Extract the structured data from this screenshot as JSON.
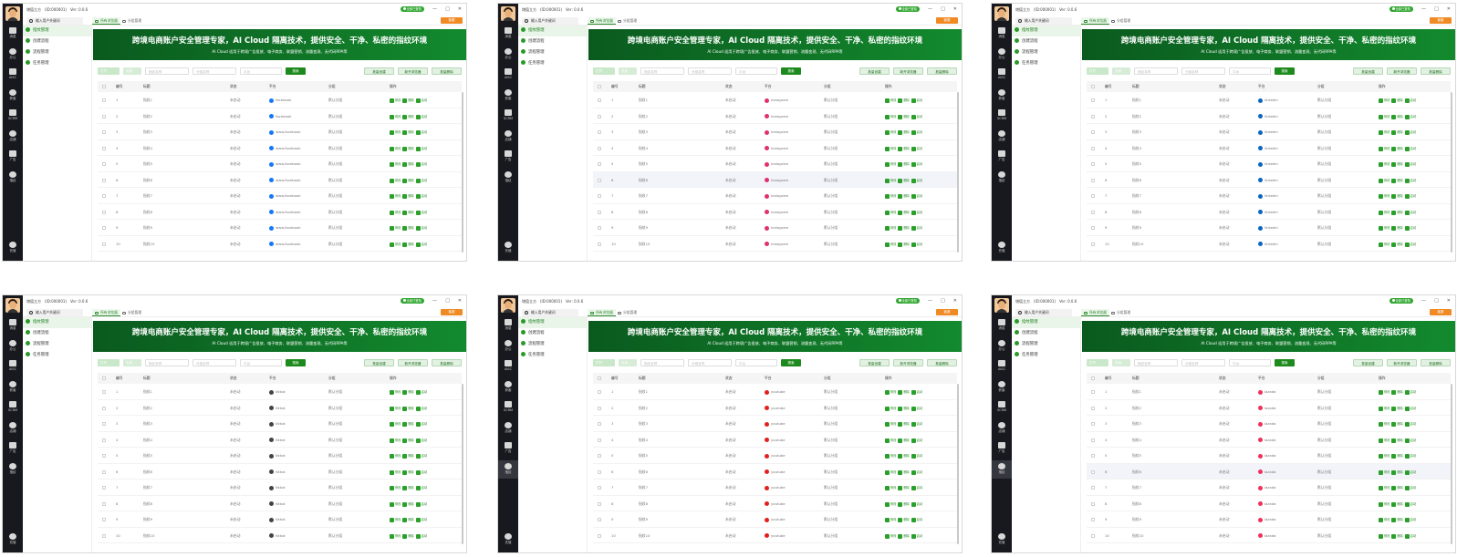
{
  "app": {
    "company": "增值立方",
    "id_label": "(ID:000001)",
    "version": "Ver: 0.0.6",
    "online_label": "全部已登陆",
    "service_label": "客服",
    "search_placeholder": "输入用户关键词"
  },
  "nav": [
    {
      "label": "消息",
      "icon": "chat-icon"
    },
    {
      "label": "办公",
      "icon": "office-icon"
    },
    {
      "label": "AISC",
      "icon": "aisc-icon"
    },
    {
      "label": "获客",
      "icon": "user-icon"
    },
    {
      "label": "SCRM",
      "icon": "scrm-icon"
    },
    {
      "label": "店铺",
      "icon": "shop-icon"
    },
    {
      "label": "广告",
      "icon": "ad-icon"
    },
    {
      "label": "指纹",
      "icon": "fingerprint-icon"
    }
  ],
  "nav_bottom": {
    "label": "充值",
    "icon": "recharge-icon"
  },
  "tabs": [
    "所有浏览器",
    "分组管理"
  ],
  "menu": [
    "指纹管理",
    "创建流程",
    "流程管理",
    "任务管理"
  ],
  "banner": {
    "title": "跨境电商账户安全管理专家，AI Cloud 隔离技术，提供安全、干净、私密的指纹环境",
    "subtitle": "AI Cloud 适用于跨境广告投放、电子商务、联盟营销、流量变现、无代码RPA等"
  },
  "toolbar": {
    "open": "打开",
    "close": "关闭",
    "name_placeholder": "指纹名称",
    "group_placeholder": "分组名称",
    "platform_placeholder": "平台",
    "search": "搜索",
    "batch_create": "批量创建",
    "new_window": "新开浏览器",
    "batch_delete": "批量删除"
  },
  "columns": [
    "编号",
    "标题",
    "状态",
    "平台",
    "分组",
    "操作"
  ],
  "actions": [
    "修改",
    "删除",
    "启动"
  ],
  "row_status": "未启动",
  "row_group": "默认分组",
  "row_titles": [
    "指纹1",
    "指纹2",
    "指纹3",
    "指纹4",
    "指纹5",
    "指纹6",
    "指纹7",
    "指纹8",
    "指纹9",
    "指纹10"
  ],
  "row_numbers": [
    "1",
    "2",
    "3",
    "4",
    "5",
    "6",
    "7",
    "8",
    "9",
    "10"
  ],
  "panels": [
    {
      "platform_name": "facebook",
      "platform_icon": "facebook-icon",
      "platform_color": "#1877f2",
      "row_platforms": [
        "facebook",
        "facebook",
        "www.facebook",
        "www.facebook",
        "www.facebook",
        "www.facebook",
        "www.facebook",
        "www.facebook",
        "www.facebook",
        "www.facebook"
      ],
      "highlight_row": -1,
      "active_nav": -1
    },
    {
      "platform_name": "instagram",
      "platform_icon": "instagram-icon",
      "platform_color": "#e1306c",
      "row_platforms": [
        "instagram",
        "instagram",
        "instagram",
        "instagram",
        "instagram",
        "instagram",
        "instagram",
        "instagram",
        "instagram",
        "instagram"
      ],
      "highlight_row": 5,
      "active_nav": -1
    },
    {
      "platform_name": "linkedin",
      "platform_icon": "linkedin-icon",
      "platform_color": "#0a66c2",
      "row_platforms": [
        "linkedin",
        "linkedin",
        "linkedin",
        "linkedin",
        "linkedin",
        "linkedin",
        "linkedin",
        "linkedin",
        "linkedin",
        "linkedin"
      ],
      "highlight_row": -1,
      "active_nav": -1
    },
    {
      "platform_name": "tiktok",
      "platform_icon": "tiktok-icon",
      "platform_color": "#444444",
      "row_platforms": [
        "tiktok",
        "tiktok",
        "tiktok",
        "tiktok",
        "tiktok",
        "tiktok",
        "tiktok",
        "tiktok",
        "tiktok",
        "tiktok"
      ],
      "highlight_row": -1,
      "active_nav": -1
    },
    {
      "platform_name": "youtube",
      "platform_icon": "youtube-icon",
      "platform_color": "#e02020",
      "row_platforms": [
        "youtube",
        "youtube",
        "youtube",
        "youtube",
        "youtube",
        "youtube",
        "youtube",
        "youtube",
        "youtube",
        "youtube"
      ],
      "highlight_row": -1,
      "active_nav": 7
    },
    {
      "platform_name": "lazada",
      "platform_icon": "lazada-icon",
      "platform_color": "#f0305a",
      "row_platforms": [
        "lazada",
        "lazada",
        "lazada",
        "lazada",
        "lazada",
        "lazada",
        "lazada",
        "lazada",
        "lazada",
        "lazada"
      ],
      "highlight_row": 5,
      "active_nav": 7
    }
  ]
}
